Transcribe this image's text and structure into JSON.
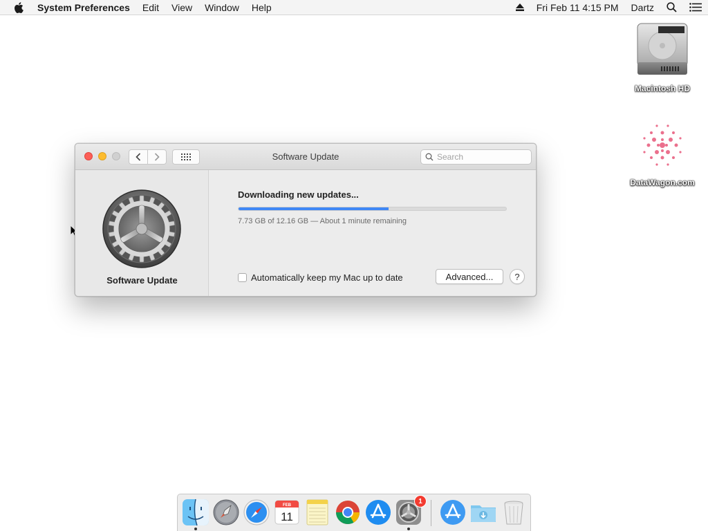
{
  "menubar": {
    "app_name": "System Preferences",
    "menus": [
      "Edit",
      "View",
      "Window",
      "Help"
    ],
    "datetime": "Fri Feb 11  4:15 PM",
    "user": "Dartz"
  },
  "desktop": {
    "icons": [
      {
        "label": "Macintosh HD",
        "icon": "hard-drive-icon"
      },
      {
        "label": "DataWagon.com",
        "icon": "datawagon-logo-icon"
      }
    ]
  },
  "window": {
    "title": "Software Update",
    "search_placeholder": "Search",
    "sidebar_title": "Software Update",
    "status_title": "Downloading new updates...",
    "progress_fraction": 0.56,
    "status_detail": "7.73 GB of 12.16 GB — About 1 minute remaining",
    "auto_update_label": "Automatically keep my Mac up to date",
    "auto_update_checked": false,
    "advanced_button": "Advanced...",
    "help_button": "?"
  },
  "dock": {
    "items": [
      {
        "name": "Finder",
        "icon": "finder-icon",
        "running": true
      },
      {
        "name": "Launchpad",
        "icon": "launchpad-icon",
        "running": false
      },
      {
        "name": "Safari",
        "icon": "safari-icon",
        "running": false
      },
      {
        "name": "Calendar",
        "icon": "calendar-icon",
        "running": false,
        "month": "FEB",
        "day": "11"
      },
      {
        "name": "Notes",
        "icon": "notes-icon",
        "running": false
      },
      {
        "name": "Chrome",
        "icon": "chrome-icon",
        "running": false
      },
      {
        "name": "App Store",
        "icon": "app-store-icon",
        "running": false
      },
      {
        "name": "System Preferences",
        "icon": "system-preferences-icon",
        "running": true,
        "badge": "1"
      },
      {
        "name": "App Store Downloads",
        "icon": "app-store-icon",
        "running": false
      },
      {
        "name": "Downloads",
        "icon": "downloads-folder-icon",
        "running": false
      },
      {
        "name": "Trash",
        "icon": "trash-icon",
        "running": false
      }
    ]
  },
  "colors": {
    "accent": "#3f87f5",
    "close": "#fc5f57",
    "minimize": "#fdbc2e",
    "badge": "#f33b30"
  }
}
